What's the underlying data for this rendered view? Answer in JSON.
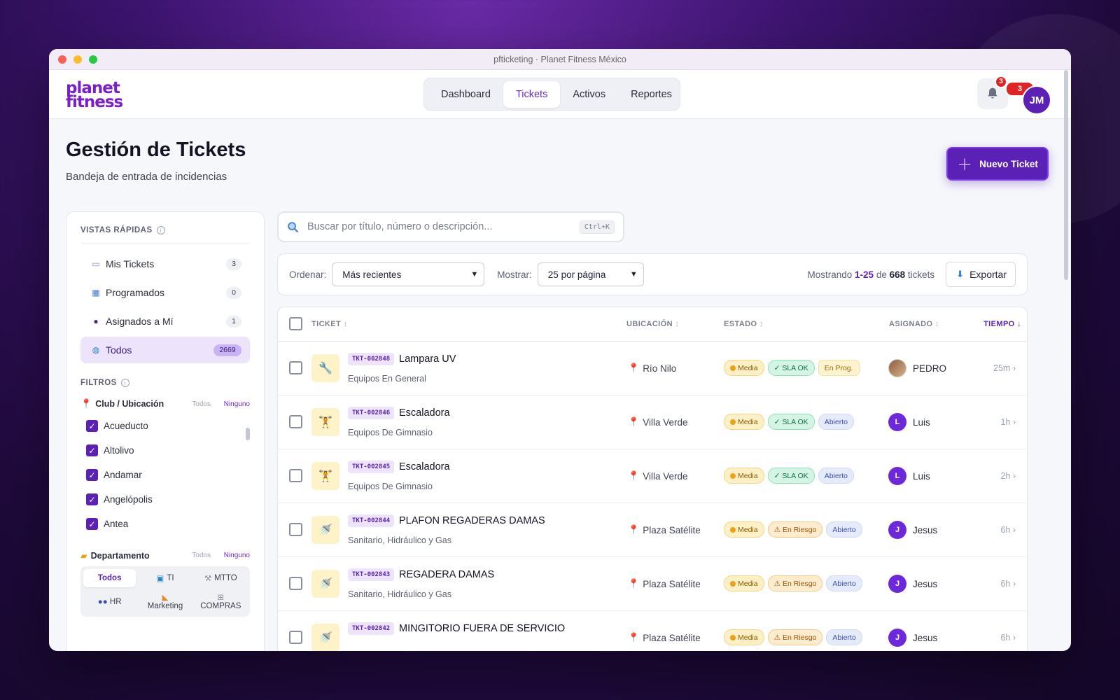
{
  "window": {
    "title": "pfticketing · Planet Fitness México"
  },
  "brand": {
    "logo_line1": "planet",
    "logo_line2": "fitness",
    "accent": "#5b21b6"
  },
  "nav": {
    "items": [
      "Dashboard",
      "Tickets",
      "Activos",
      "Reportes"
    ],
    "active": "Tickets"
  },
  "header": {
    "notifications_count": "3",
    "profile_badge_count": "3",
    "user_initials": "JM",
    "icons": [
      "bell-icon"
    ]
  },
  "page": {
    "title": "Gestión de Tickets",
    "subtitle": "Bandeja de entrada de incidencias",
    "new_ticket_label": "Nuevo Ticket"
  },
  "sidebar": {
    "quick_views_title": "VISTAS RÁPIDAS",
    "quick_views": [
      {
        "label": "Mis Tickets",
        "count": "3",
        "icon": "inbox-icon"
      },
      {
        "label": "Programados",
        "count": "0",
        "icon": "calendar-icon"
      },
      {
        "label": "Asignados a Mí",
        "count": "1",
        "icon": "person-icon"
      },
      {
        "label": "Todos",
        "count": "2669",
        "icon": "globe-icon",
        "active": true
      }
    ],
    "filters_title": "FILTROS",
    "club_filter": {
      "label": "Club / Ubicación",
      "all": "Todos",
      "none": "Ninguno",
      "options": [
        "Acueducto",
        "Altolivo",
        "Andamar",
        "Angelópolis",
        "Antea"
      ]
    },
    "dept_filter": {
      "label": "Departamento",
      "all": "Todos",
      "none": "Ninguno",
      "options": [
        "Todos",
        "TI",
        "MTTO",
        "HR",
        "Marketing",
        "COMPRAS"
      ]
    }
  },
  "search": {
    "placeholder": "Buscar por título, número o descripción...",
    "shortcut": "Ctrl+K"
  },
  "toolbar": {
    "order_label": "Ordenar:",
    "order_value": "Más recientes",
    "show_label": "Mostrar:",
    "show_value": "25 por página",
    "showing_prefix": "Mostrando",
    "range": "1-25",
    "of": "de",
    "total": "668",
    "suffix": "tickets",
    "export_label": "Exportar"
  },
  "table": {
    "columns": [
      "TICKET",
      "UBICACIÓN",
      "ESTADO",
      "ASIGNADO",
      "TIEMPO ↓"
    ],
    "rows": [
      {
        "id": "TKT-002848",
        "title": "Lampara UV",
        "category": "Equipos En General",
        "location": "Río Nilo",
        "priority": "Media",
        "sla": "✓ SLA OK",
        "sla_type": "ok",
        "status": "En Prog.",
        "status_type": "prog",
        "assignee": "PEDRO",
        "assignee_initial": "",
        "time": "25m",
        "icon": "wrench-icon"
      },
      {
        "id": "TKT-002846",
        "title": "Escaladora",
        "category": "Equipos De Gimnasio",
        "location": "Villa Verde",
        "priority": "Media",
        "sla": "✓ SLA OK",
        "sla_type": "ok",
        "status": "Abierto",
        "status_type": "open",
        "assignee": "Luis",
        "assignee_initial": "L",
        "time": "1h",
        "icon": "dumbbell-icon"
      },
      {
        "id": "TKT-002845",
        "title": "Escaladora",
        "category": "Equipos De Gimnasio",
        "location": "Villa Verde",
        "priority": "Media",
        "sla": "✓ SLA OK",
        "sla_type": "ok",
        "status": "Abierto",
        "status_type": "open",
        "assignee": "Luis",
        "assignee_initial": "L",
        "time": "2h",
        "icon": "dumbbell-icon"
      },
      {
        "id": "TKT-002844",
        "title": "PLAFON REGADERAS DAMAS",
        "category": "Sanitario, Hidráulico y Gas",
        "location": "Plaza Satélite",
        "priority": "Media",
        "sla": "⚠ En Riesgo",
        "sla_type": "risk",
        "status": "Abierto",
        "status_type": "open",
        "assignee": "Jesus",
        "assignee_initial": "J",
        "time": "6h",
        "icon": "shower-icon"
      },
      {
        "id": "TKT-002843",
        "title": "REGADERA DAMAS",
        "category": "Sanitario, Hidráulico y Gas",
        "location": "Plaza Satélite",
        "priority": "Media",
        "sla": "⚠ En Riesgo",
        "sla_type": "risk",
        "status": "Abierto",
        "status_type": "open",
        "assignee": "Jesus",
        "assignee_initial": "J",
        "time": "6h",
        "icon": "shower-icon"
      },
      {
        "id": "TKT-002842",
        "title": "MINGITORIO FUERA DE SERVICIO",
        "category": "",
        "location": "Plaza Satélite",
        "priority": "Media",
        "sla": "⚠ En Riesgo",
        "sla_type": "risk",
        "status": "Abierto",
        "status_type": "open",
        "assignee": "Jesus",
        "assignee_initial": "J",
        "time": "6h",
        "icon": "shower-icon"
      }
    ]
  }
}
